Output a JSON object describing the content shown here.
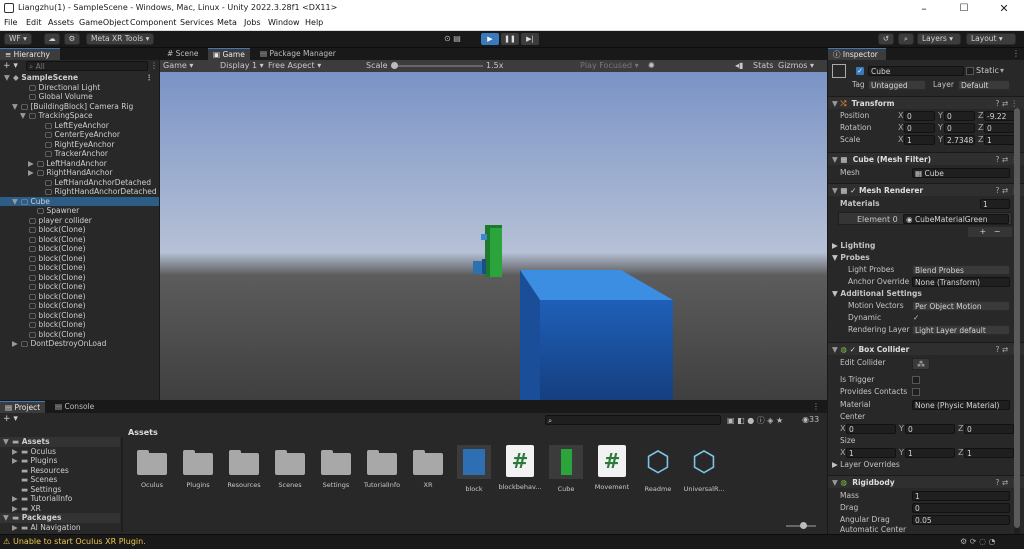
{
  "window": {
    "title": "Liangzhu(1) - SampleScene - Windows, Mac, Linux - Unity 2022.3.28f1 <DX11>",
    "min": "–",
    "max": "☐",
    "close": "✕"
  },
  "menu": [
    "File",
    "Edit",
    "Assets",
    "GameObject",
    "Component",
    "Services",
    "Meta",
    "Jobs",
    "Window",
    "Help"
  ],
  "toolbar": {
    "account": "WF ▾",
    "meta": "Meta XR Tools ▾",
    "layers": "Layers ▾",
    "layout": "Layout ▾"
  },
  "hierarchy": {
    "tab": "Hierarchy",
    "search_placeholder": "All",
    "rows": [
      {
        "label": "SampleScene",
        "indent": 0,
        "arrow": "▼",
        "bold": true
      },
      {
        "label": "Directional Light",
        "indent": 2
      },
      {
        "label": "Global Volume",
        "indent": 2
      },
      {
        "label": "[BuildingBlock] Camera Rig",
        "indent": 1,
        "arrow": "▼"
      },
      {
        "label": "TrackingSpace",
        "indent": 2,
        "arrow": "▼"
      },
      {
        "label": "LeftEyeAnchor",
        "indent": 4
      },
      {
        "label": "CenterEyeAnchor",
        "indent": 4
      },
      {
        "label": "RightEyeAnchor",
        "indent": 4
      },
      {
        "label": "TrackerAnchor",
        "indent": 4
      },
      {
        "label": "LeftHandAnchor",
        "indent": 3,
        "arrow": "▶"
      },
      {
        "label": "RightHandAnchor",
        "indent": 3,
        "arrow": "▶"
      },
      {
        "label": "LeftHandAnchorDetached",
        "indent": 4
      },
      {
        "label": "RightHandAnchorDetached",
        "indent": 4
      },
      {
        "label": "Cube",
        "indent": 1,
        "arrow": "▼",
        "selected": true
      },
      {
        "label": "Spawner",
        "indent": 3
      },
      {
        "label": "player collider",
        "indent": 2
      },
      {
        "label": "block(Clone)",
        "indent": 2
      },
      {
        "label": "block(Clone)",
        "indent": 2
      },
      {
        "label": "block(Clone)",
        "indent": 2
      },
      {
        "label": "block(Clone)",
        "indent": 2
      },
      {
        "label": "block(Clone)",
        "indent": 2
      },
      {
        "label": "block(Clone)",
        "indent": 2
      },
      {
        "label": "block(Clone)",
        "indent": 2
      },
      {
        "label": "block(Clone)",
        "indent": 2
      },
      {
        "label": "block(Clone)",
        "indent": 2
      },
      {
        "label": "block(Clone)",
        "indent": 2
      },
      {
        "label": "block(Clone)",
        "indent": 2
      },
      {
        "label": "block(Clone)",
        "indent": 2
      },
      {
        "label": "DontDestroyOnLoad",
        "indent": 1,
        "arrow": "▶"
      }
    ]
  },
  "center": {
    "tabs": [
      "Scene",
      "Game",
      "Package Manager"
    ],
    "game_mode": "Game",
    "display": "Display 1",
    "aspect": "Free Aspect",
    "scale_label": "Scale",
    "scale_value": "1.5x",
    "play_focused": "Play Focused",
    "stats": "Stats",
    "gizmos": "Gizmos"
  },
  "inspector": {
    "tab": "Inspector",
    "object_name": "Cube",
    "static_label": "Static",
    "tag_label": "Tag",
    "tag_value": "Untagged",
    "layer_label": "Layer",
    "layer_value": "Default",
    "transform": {
      "title": "Transform",
      "position": {
        "label": "Position",
        "x": "0",
        "y": "0",
        "z": "-9.22"
      },
      "rotation": {
        "label": "Rotation",
        "x": "0",
        "y": "0",
        "z": "0"
      },
      "scale": {
        "label": "Scale",
        "x": "1",
        "y": "2.7348",
        "z": "1"
      }
    },
    "mesh_filter": {
      "title": "Cube (Mesh Filter)",
      "mesh_label": "Mesh",
      "mesh_value": "Cube"
    },
    "mesh_renderer": {
      "title": "Mesh Renderer",
      "materials_label": "Materials",
      "materials_count": "1",
      "element_label": "Element 0",
      "element_value": "CubeMaterialGreen",
      "lighting": "Lighting",
      "probes": "Probes",
      "light_probes_label": "Light Probes",
      "light_probes_value": "Blend Probes",
      "anchor_label": "Anchor Override",
      "anchor_value": "None (Transform)",
      "additional": "Additional Settings",
      "motion_label": "Motion Vectors",
      "motion_value": "Per Object Motion",
      "dynamic_label": "Dynamic Occlusic",
      "rendering_label": "Rendering Layer M",
      "rendering_value": "Light Layer default"
    },
    "box_collider": {
      "title": "Box Collider",
      "edit_label": "Edit Collider",
      "trigger_label": "Is Trigger",
      "contacts_label": "Provides Contacts",
      "material_label": "Material",
      "material_value": "None (Physic Material)",
      "center_label": "Center",
      "center": {
        "x": "0",
        "y": "0",
        "z": "0"
      },
      "size_label": "Size",
      "size": {
        "x": "1",
        "y": "1",
        "z": "1"
      },
      "overrides": "Layer Overrides"
    },
    "rigidbody": {
      "title": "Rigidbody",
      "mass_label": "Mass",
      "mass": "1",
      "drag_label": "Drag",
      "drag": "0",
      "angular_label": "Angular Drag",
      "angular": "0.05",
      "auto_label": "Automatic Center Of"
    }
  },
  "project": {
    "tabs": [
      "Project",
      "Console"
    ],
    "breadcrumb": "Assets",
    "count": "33",
    "tree": [
      {
        "label": "Assets",
        "indent": 0,
        "bold": true,
        "arrow": "▼"
      },
      {
        "label": "Oculus",
        "indent": 1,
        "arrow": "▶"
      },
      {
        "label": "Plugins",
        "indent": 1,
        "arrow": "▶"
      },
      {
        "label": "Resources",
        "indent": 1
      },
      {
        "label": "Scenes",
        "indent": 1
      },
      {
        "label": "Settings",
        "indent": 1
      },
      {
        "label": "TutorialInfo",
        "indent": 1,
        "arrow": "▶"
      },
      {
        "label": "XR",
        "indent": 1,
        "arrow": "▶"
      },
      {
        "label": "Packages",
        "indent": 0,
        "bold": true,
        "arrow": "▼"
      },
      {
        "label": "AI Navigation",
        "indent": 1,
        "arrow": "▶"
      }
    ],
    "assets": [
      {
        "label": "Oculus",
        "kind": "folder"
      },
      {
        "label": "Plugins",
        "kind": "folder"
      },
      {
        "label": "Resources",
        "kind": "folder"
      },
      {
        "label": "Scenes",
        "kind": "folder"
      },
      {
        "label": "Settings",
        "kind": "folder"
      },
      {
        "label": "TutorialInfo",
        "kind": "folder"
      },
      {
        "label": "XR",
        "kind": "folder"
      },
      {
        "label": "block",
        "kind": "prefab-blue"
      },
      {
        "label": "blockbehav...",
        "kind": "script"
      },
      {
        "label": "Cube",
        "kind": "prefab-green"
      },
      {
        "label": "Movement",
        "kind": "script"
      },
      {
        "label": "Readme",
        "kind": "package"
      },
      {
        "label": "UniversalR...",
        "kind": "package"
      }
    ]
  },
  "status": {
    "message": "Unable to start Oculus XR Plugin."
  },
  "colors": {
    "selection": "#2c5d87",
    "accent": "#3a79bb",
    "warning": "#f0c850",
    "sky_top": "#7d95c4",
    "sky_bottom": "#b7c2d6",
    "ground": "#4a4a4a"
  }
}
